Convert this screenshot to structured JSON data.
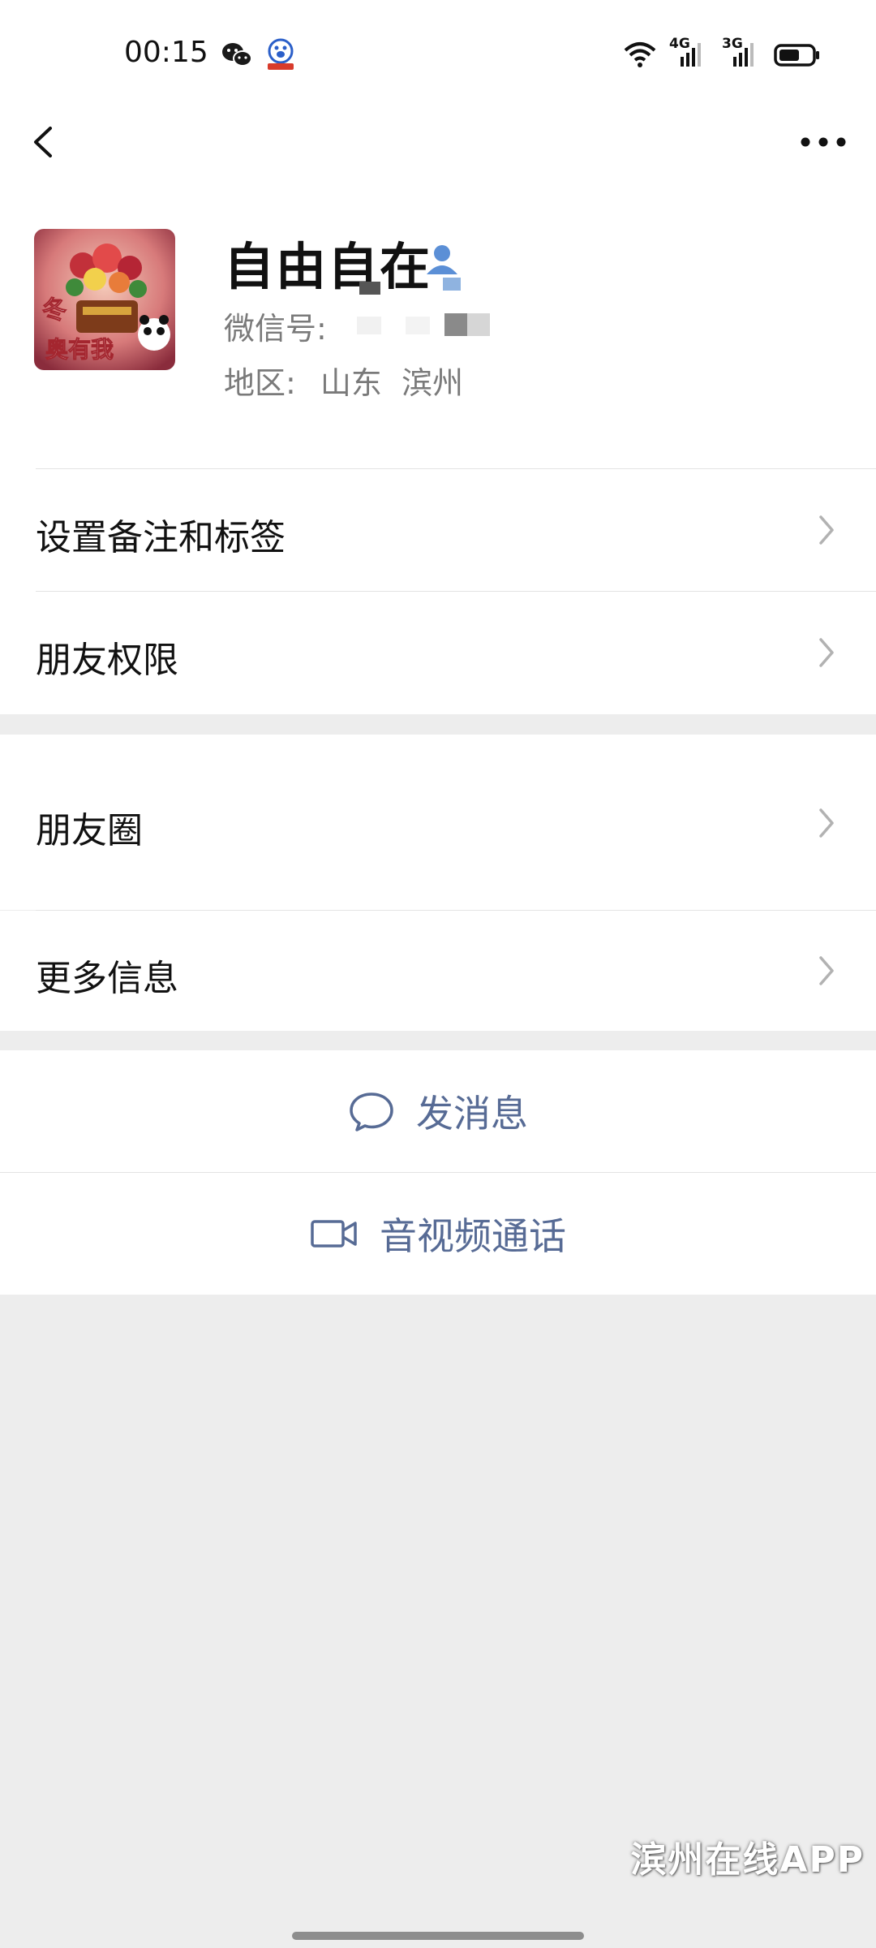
{
  "status_bar": {
    "time": "00:15",
    "network_1": "4G",
    "network_2": "3G",
    "icons": [
      "wechat-icon",
      "baidu-icon",
      "wifi-icon",
      "signal-4g-icon",
      "signal-3g-icon",
      "battery-icon"
    ]
  },
  "nav": {
    "back_icon": "chevron-left-icon",
    "more_icon": "more-dots-icon"
  },
  "profile": {
    "name": "自由自在",
    "wechat_id_label": "微信号:",
    "region_label": "地区:",
    "region_value": "山东  滨州",
    "avatar_text_1": "冬",
    "avatar_text_2": "奥有我"
  },
  "menu_group_1": [
    {
      "label": "设置备注和标签"
    },
    {
      "label": "朋友权限"
    }
  ],
  "menu_group_2": [
    {
      "label": "朋友圈"
    },
    {
      "label": "更多信息"
    }
  ],
  "actions": {
    "message_label": "发消息",
    "call_label": "音视频通话"
  },
  "watermark": "滨州在线APP",
  "colors": {
    "link_blue": "#576b95",
    "background": "#ededed",
    "text_primary": "#111111",
    "text_secondary": "#7a7a7a"
  }
}
